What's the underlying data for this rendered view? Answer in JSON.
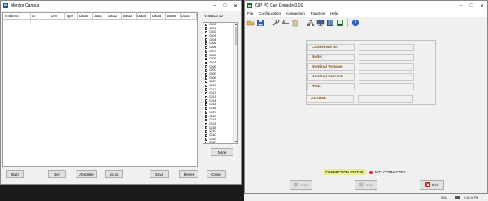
{
  "monitor_window": {
    "title": "Monitor Canbus",
    "columns": [
      "Timebrnd",
      "ID",
      "Len",
      "Type",
      "Data0",
      "Data1",
      "Data2",
      "Data3",
      "Data4",
      "Data5",
      "Data6",
      "Data7"
    ],
    "visible_id_label": "VISIBLE ID",
    "visible_ids": [
      "0000",
      "0001",
      "0002",
      "0003",
      "0004",
      "0005",
      "0006",
      "0007",
      "0008",
      "0009",
      "000A",
      "000B",
      "000C",
      "000D",
      "000E",
      "000F",
      "0010",
      "0011",
      "0012",
      "0013",
      "0014",
      "0015",
      "0016",
      "0017",
      "0018",
      "0019",
      "001A",
      "001B",
      "001C",
      "001D",
      "001E",
      "001F",
      "0020"
    ],
    "none_button": "None",
    "buttons": {
      "start": "Start",
      "dec": "Dec",
      "absolute": "Absolute",
      "us": "us.ns",
      "save": "Save",
      "reset": "Reset",
      "close": "Close"
    }
  },
  "console_window": {
    "title": "ZZP PC Can Console 0.16",
    "menu": [
      "File",
      "Configuration",
      "Connection",
      "Function",
      "Help"
    ],
    "info_fields": [
      "Connected to:",
      "Node:",
      "Nominal Voltage:",
      "Nominal Current:",
      "Hour:"
    ],
    "alarm_label": "ALARM:",
    "connection_status_label": "CONNECTION STATUS:",
    "connection_status_value": "NOT CONNECTED",
    "buttons": {
      "start": "Start",
      "stop": "Stop",
      "exit": "Exit"
    }
  },
  "taskbar": {
    "lang": "NUM",
    "time": "5:45:16 PM"
  },
  "colors": {
    "label_text": "#7a4f22",
    "status_bg": "#e9f08a",
    "led_red": "#d62020",
    "exit_red": "#cc1f1f"
  }
}
